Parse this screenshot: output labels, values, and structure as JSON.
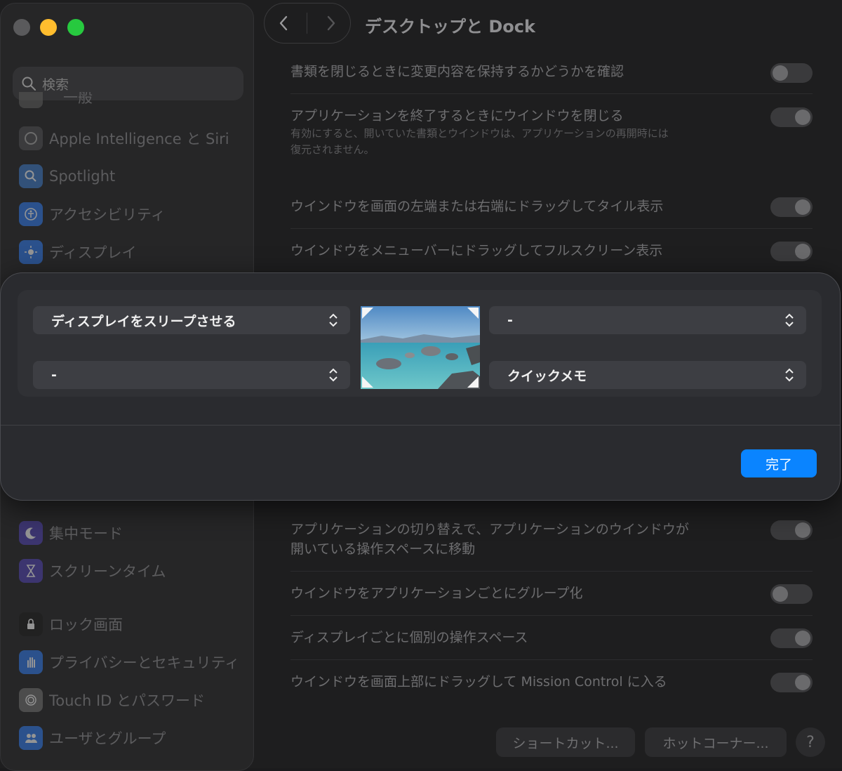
{
  "sidebar": {
    "search_placeholder": "検索",
    "items": [
      {
        "label": "一般",
        "icon": "gear-icon"
      },
      {
        "label": "Apple Intelligence と Siri",
        "icon": "siri-icon"
      },
      {
        "label": "Spotlight",
        "icon": "spotlight-icon"
      },
      {
        "label": "アクセシビリティ",
        "icon": "accessibility-icon"
      },
      {
        "label": "ディスプレイ",
        "icon": "display-brightness-icon"
      },
      {
        "label": "集中モード",
        "icon": "moon-icon"
      },
      {
        "label": "スクリーンタイム",
        "icon": "hourglass-icon"
      },
      {
        "label": "ロック画面",
        "icon": "lock-icon"
      },
      {
        "label": "プライバシーとセキュリティ",
        "icon": "hand-icon"
      },
      {
        "label": "Touch ID とパスワード",
        "icon": "fingerprint-icon"
      },
      {
        "label": "ユーザとグループ",
        "icon": "users-icon"
      }
    ]
  },
  "header": {
    "title": "デスクトップと Dock"
  },
  "settings": [
    {
      "title": "書類を閉じるときに変更内容を保持するかどうかを確認",
      "state": "off"
    },
    {
      "title": "アプリケーションを終了するときにウインドウを閉じる",
      "subtitle_line1": "有効にすると、開いていた書類とウインドウは、アプリケーションの再開時には",
      "subtitle_line2": "復元されません。",
      "state": "on"
    },
    {
      "title": "ウインドウを画面の左端または右端にドラッグしてタイル表示",
      "state": "on"
    },
    {
      "title": "ウインドウをメニューバーにドラッグしてフルスクリーン表示",
      "state": "on"
    },
    {
      "title_line1": "アプリケーションの切り替えで、アプリケーションのウインドウが",
      "title_line2": "開いている操作スペースに移動",
      "state": "on"
    },
    {
      "title": "ウインドウをアプリケーションごとにグループ化",
      "state": "off"
    },
    {
      "title": "ディスプレイごとに個別の操作スペース",
      "state": "on"
    },
    {
      "title": "ウインドウを画面上部にドラッグして Mission Control に入る",
      "state": "on"
    }
  ],
  "buttons": {
    "shortcuts": "ショートカット...",
    "hot_corners": "ホットコーナー...",
    "help": "?"
  },
  "hot_corners_sheet": {
    "top_left": "ディスプレイをスリープさせる",
    "top_right": "-",
    "bottom_left": "-",
    "bottom_right": "クイックメモ",
    "done": "完了"
  },
  "colors": {
    "accent": "#0a84ff",
    "sheet_bg": "#2a2b2f"
  }
}
